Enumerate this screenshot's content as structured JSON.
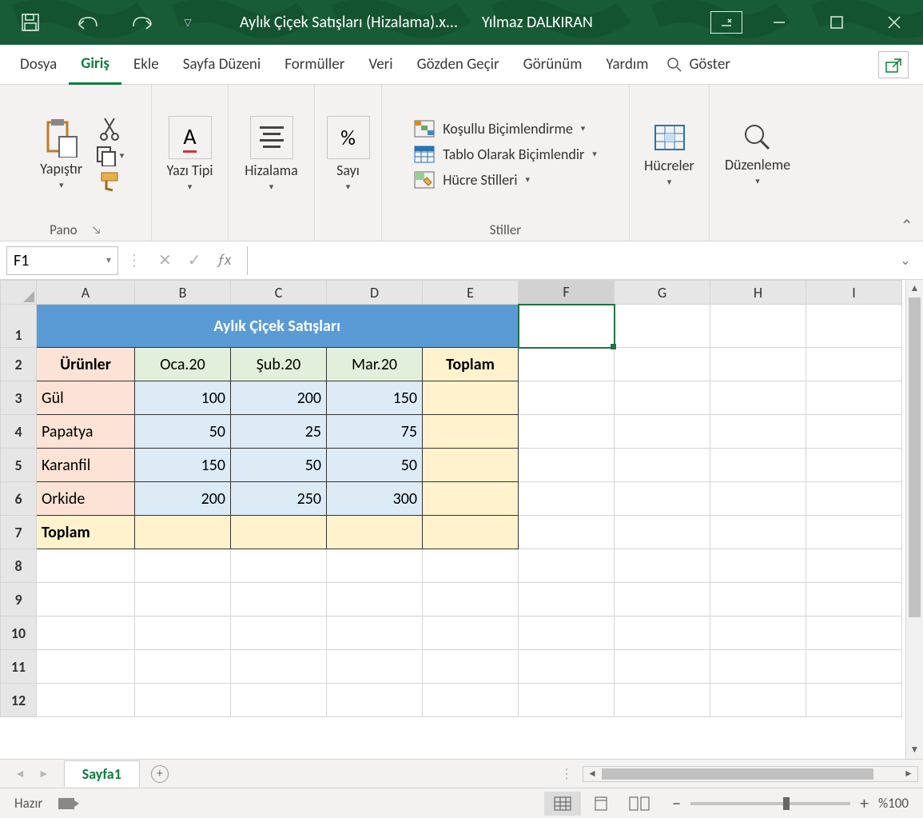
{
  "titleBar": {
    "documentTitle": "Aylık Çiçek Satışları (Hizalama).x...",
    "userName": "Yılmaz DALKIRAN"
  },
  "tabs": {
    "items": [
      "Dosya",
      "Giriş",
      "Ekle",
      "Sayfa Düzeni",
      "Formüller",
      "Veri",
      "Gözden Geçir",
      "Görünüm",
      "Yardım"
    ],
    "activeIndex": 1,
    "searchLabel": "Göster"
  },
  "ribbon": {
    "pano": {
      "label": "Pano",
      "paste": "Yapıştır"
    },
    "font": {
      "label": "Yazı Tipi"
    },
    "align": {
      "label": "Hizalama"
    },
    "number": {
      "label": "Sayı"
    },
    "styles": {
      "label": "Stiller",
      "conditional": "Koşullu Biçimlendirme",
      "formatTable": "Tablo Olarak Biçimlendir",
      "cellStyles": "Hücre Stilleri"
    },
    "cells": {
      "label": "Hücreler"
    },
    "editing": {
      "label": "Düzenleme"
    }
  },
  "formulaBar": {
    "nameBox": "F1",
    "formula": ""
  },
  "grid": {
    "columns": [
      "A",
      "B",
      "C",
      "D",
      "E",
      "F",
      "G",
      "H",
      "I"
    ],
    "activeCell": "F1",
    "rowCount": 12,
    "title": "Aylık Çiçek Satışları",
    "headers": {
      "products": "Ürünler",
      "months": [
        "Oca.20",
        "Şub.20",
        "Mar.20"
      ],
      "total": "Toplam"
    },
    "rows": [
      {
        "name": "Gül",
        "vals": [
          "100",
          "200",
          "150"
        ]
      },
      {
        "name": "Papatya",
        "vals": [
          "50",
          "25",
          "75"
        ]
      },
      {
        "name": "Karanfil",
        "vals": [
          "150",
          "50",
          "50"
        ]
      },
      {
        "name": "Orkide",
        "vals": [
          "200",
          "250",
          "300"
        ]
      }
    ],
    "totalLabel": "Toplam"
  },
  "sheetTabs": {
    "active": "Sayfa1"
  },
  "status": {
    "ready": "Hazır",
    "zoom": "%100"
  }
}
